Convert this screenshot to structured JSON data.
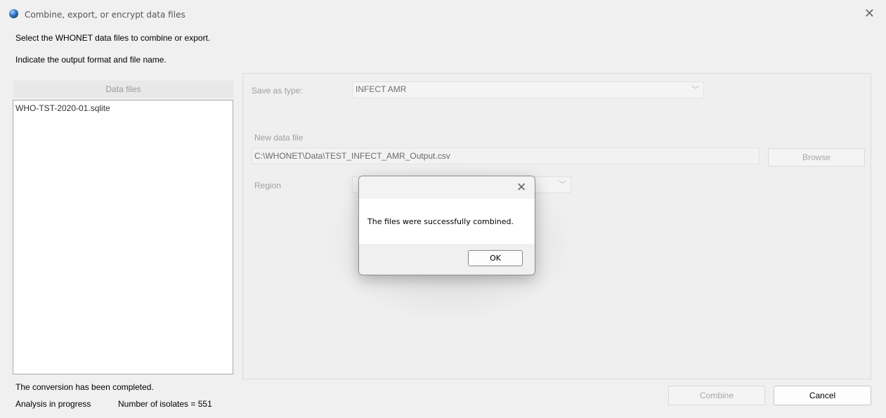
{
  "window": {
    "title": "Combine, export, or encrypt data files",
    "close_icon": "close-icon"
  },
  "instructions": {
    "line1": "Select the WHONET data files to combine or export.",
    "line2": "Indicate the output format and file name."
  },
  "data_files": {
    "header": "Data files",
    "items": [
      "WHO-TST-2020-01.sqlite"
    ]
  },
  "form": {
    "save_as_label": "Save as type:",
    "save_as_value": "INFECT AMR",
    "new_data_file_label": "New data file",
    "new_data_file_value": "C:\\WHONET\\Data\\TEST_INFECT_AMR_Output.csv",
    "browse_label": "Browse",
    "region_label": "Region",
    "region_value": ""
  },
  "status": {
    "line1": "The conversion has been completed.",
    "analysis": "Analysis in progress",
    "isolates": "Number of isolates = 551"
  },
  "buttons": {
    "combine": "Combine",
    "cancel": "Cancel"
  },
  "dialog": {
    "message": "The files were successfully combined.",
    "ok": "OK"
  }
}
